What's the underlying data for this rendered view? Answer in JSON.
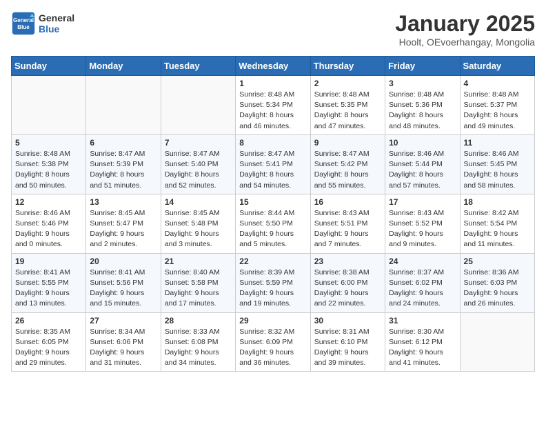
{
  "logo": {
    "line1": "General",
    "line2": "Blue"
  },
  "title": "January 2025",
  "subtitle": "Hoolt, OEvoerhangay, Mongolia",
  "days_of_week": [
    "Sunday",
    "Monday",
    "Tuesday",
    "Wednesday",
    "Thursday",
    "Friday",
    "Saturday"
  ],
  "weeks": [
    [
      {
        "num": "",
        "info": ""
      },
      {
        "num": "",
        "info": ""
      },
      {
        "num": "",
        "info": ""
      },
      {
        "num": "1",
        "info": "Sunrise: 8:48 AM\nSunset: 5:34 PM\nDaylight: 8 hours\nand 46 minutes."
      },
      {
        "num": "2",
        "info": "Sunrise: 8:48 AM\nSunset: 5:35 PM\nDaylight: 8 hours\nand 47 minutes."
      },
      {
        "num": "3",
        "info": "Sunrise: 8:48 AM\nSunset: 5:36 PM\nDaylight: 8 hours\nand 48 minutes."
      },
      {
        "num": "4",
        "info": "Sunrise: 8:48 AM\nSunset: 5:37 PM\nDaylight: 8 hours\nand 49 minutes."
      }
    ],
    [
      {
        "num": "5",
        "info": "Sunrise: 8:48 AM\nSunset: 5:38 PM\nDaylight: 8 hours\nand 50 minutes."
      },
      {
        "num": "6",
        "info": "Sunrise: 8:47 AM\nSunset: 5:39 PM\nDaylight: 8 hours\nand 51 minutes."
      },
      {
        "num": "7",
        "info": "Sunrise: 8:47 AM\nSunset: 5:40 PM\nDaylight: 8 hours\nand 52 minutes."
      },
      {
        "num": "8",
        "info": "Sunrise: 8:47 AM\nSunset: 5:41 PM\nDaylight: 8 hours\nand 54 minutes."
      },
      {
        "num": "9",
        "info": "Sunrise: 8:47 AM\nSunset: 5:42 PM\nDaylight: 8 hours\nand 55 minutes."
      },
      {
        "num": "10",
        "info": "Sunrise: 8:46 AM\nSunset: 5:44 PM\nDaylight: 8 hours\nand 57 minutes."
      },
      {
        "num": "11",
        "info": "Sunrise: 8:46 AM\nSunset: 5:45 PM\nDaylight: 8 hours\nand 58 minutes."
      }
    ],
    [
      {
        "num": "12",
        "info": "Sunrise: 8:46 AM\nSunset: 5:46 PM\nDaylight: 9 hours\nand 0 minutes."
      },
      {
        "num": "13",
        "info": "Sunrise: 8:45 AM\nSunset: 5:47 PM\nDaylight: 9 hours\nand 2 minutes."
      },
      {
        "num": "14",
        "info": "Sunrise: 8:45 AM\nSunset: 5:48 PM\nDaylight: 9 hours\nand 3 minutes."
      },
      {
        "num": "15",
        "info": "Sunrise: 8:44 AM\nSunset: 5:50 PM\nDaylight: 9 hours\nand 5 minutes."
      },
      {
        "num": "16",
        "info": "Sunrise: 8:43 AM\nSunset: 5:51 PM\nDaylight: 9 hours\nand 7 minutes."
      },
      {
        "num": "17",
        "info": "Sunrise: 8:43 AM\nSunset: 5:52 PM\nDaylight: 9 hours\nand 9 minutes."
      },
      {
        "num": "18",
        "info": "Sunrise: 8:42 AM\nSunset: 5:54 PM\nDaylight: 9 hours\nand 11 minutes."
      }
    ],
    [
      {
        "num": "19",
        "info": "Sunrise: 8:41 AM\nSunset: 5:55 PM\nDaylight: 9 hours\nand 13 minutes."
      },
      {
        "num": "20",
        "info": "Sunrise: 8:41 AM\nSunset: 5:56 PM\nDaylight: 9 hours\nand 15 minutes."
      },
      {
        "num": "21",
        "info": "Sunrise: 8:40 AM\nSunset: 5:58 PM\nDaylight: 9 hours\nand 17 minutes."
      },
      {
        "num": "22",
        "info": "Sunrise: 8:39 AM\nSunset: 5:59 PM\nDaylight: 9 hours\nand 19 minutes."
      },
      {
        "num": "23",
        "info": "Sunrise: 8:38 AM\nSunset: 6:00 PM\nDaylight: 9 hours\nand 22 minutes."
      },
      {
        "num": "24",
        "info": "Sunrise: 8:37 AM\nSunset: 6:02 PM\nDaylight: 9 hours\nand 24 minutes."
      },
      {
        "num": "25",
        "info": "Sunrise: 8:36 AM\nSunset: 6:03 PM\nDaylight: 9 hours\nand 26 minutes."
      }
    ],
    [
      {
        "num": "26",
        "info": "Sunrise: 8:35 AM\nSunset: 6:05 PM\nDaylight: 9 hours\nand 29 minutes."
      },
      {
        "num": "27",
        "info": "Sunrise: 8:34 AM\nSunset: 6:06 PM\nDaylight: 9 hours\nand 31 minutes."
      },
      {
        "num": "28",
        "info": "Sunrise: 8:33 AM\nSunset: 6:08 PM\nDaylight: 9 hours\nand 34 minutes."
      },
      {
        "num": "29",
        "info": "Sunrise: 8:32 AM\nSunset: 6:09 PM\nDaylight: 9 hours\nand 36 minutes."
      },
      {
        "num": "30",
        "info": "Sunrise: 8:31 AM\nSunset: 6:10 PM\nDaylight: 9 hours\nand 39 minutes."
      },
      {
        "num": "31",
        "info": "Sunrise: 8:30 AM\nSunset: 6:12 PM\nDaylight: 9 hours\nand 41 minutes."
      },
      {
        "num": "",
        "info": ""
      }
    ]
  ]
}
